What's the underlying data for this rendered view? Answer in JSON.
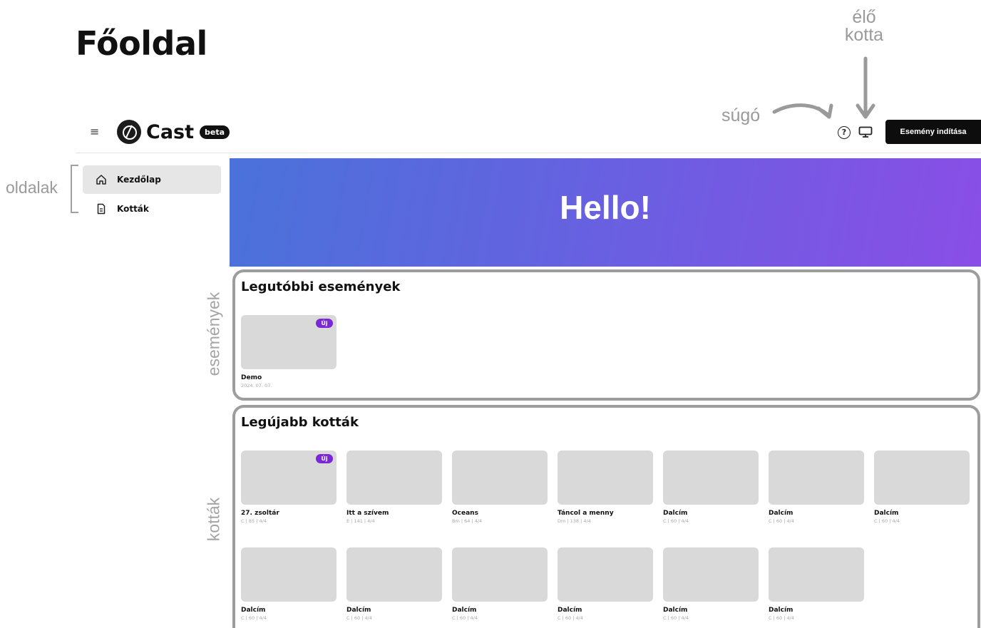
{
  "annotations": {
    "page_title": "Főoldal",
    "live_score": "élő\nkotta",
    "help": "súgó",
    "pages": "oldalak",
    "events": "események",
    "scores": "kották"
  },
  "header": {
    "app_name": "Cast",
    "beta_label": "beta",
    "help_icon_glyph": "?",
    "start_button_label": "Esemény indítása"
  },
  "sidebar": {
    "items": [
      {
        "label": "Kezdőlap",
        "icon": "home-icon",
        "active": true
      },
      {
        "label": "Kották",
        "icon": "document-icon",
        "active": false
      }
    ]
  },
  "hero": {
    "text": "Hello!"
  },
  "events": {
    "title": "Legutóbbi események",
    "items": [
      {
        "title": "Demo",
        "meta": "2024. 07. 07.",
        "badge": "Új"
      }
    ]
  },
  "scores": {
    "title": "Legújabb kották",
    "items": [
      {
        "title": "27. zsoltár",
        "meta": "C | 85 | 4/4",
        "badge": "Új"
      },
      {
        "title": "Itt a szívem",
        "meta": "E | 141 | 4/4"
      },
      {
        "title": "Oceans",
        "meta": "Bm | 64 | 4/4"
      },
      {
        "title": "Táncol a menny",
        "meta": "Dm | 138 | 4/4"
      },
      {
        "title": "Dalcím",
        "meta": "C | 60 | 4/4"
      },
      {
        "title": "Dalcím",
        "meta": "C | 60 | 4/4"
      },
      {
        "title": "Dalcím",
        "meta": "C | 60 | 4/4"
      },
      {
        "title": "Dalcím",
        "meta": "C | 60 | 4/4"
      },
      {
        "title": "Dalcím",
        "meta": "C | 60 | 4/4"
      },
      {
        "title": "Dalcím",
        "meta": "C | 60 | 4/4"
      },
      {
        "title": "Dalcím",
        "meta": "C | 60 | 4/4"
      },
      {
        "title": "Dalcím",
        "meta": "C | 60 | 4/4"
      },
      {
        "title": "Dalcím",
        "meta": "C | 60 | 4/4"
      }
    ]
  },
  "colors": {
    "annotation_gray": "#9a9a9a",
    "new_badge": "#7a27d8",
    "hero_gradient_start": "#4a72da",
    "hero_gradient_end": "#8a4ee6",
    "start_button_bg": "#0d0d0d"
  }
}
